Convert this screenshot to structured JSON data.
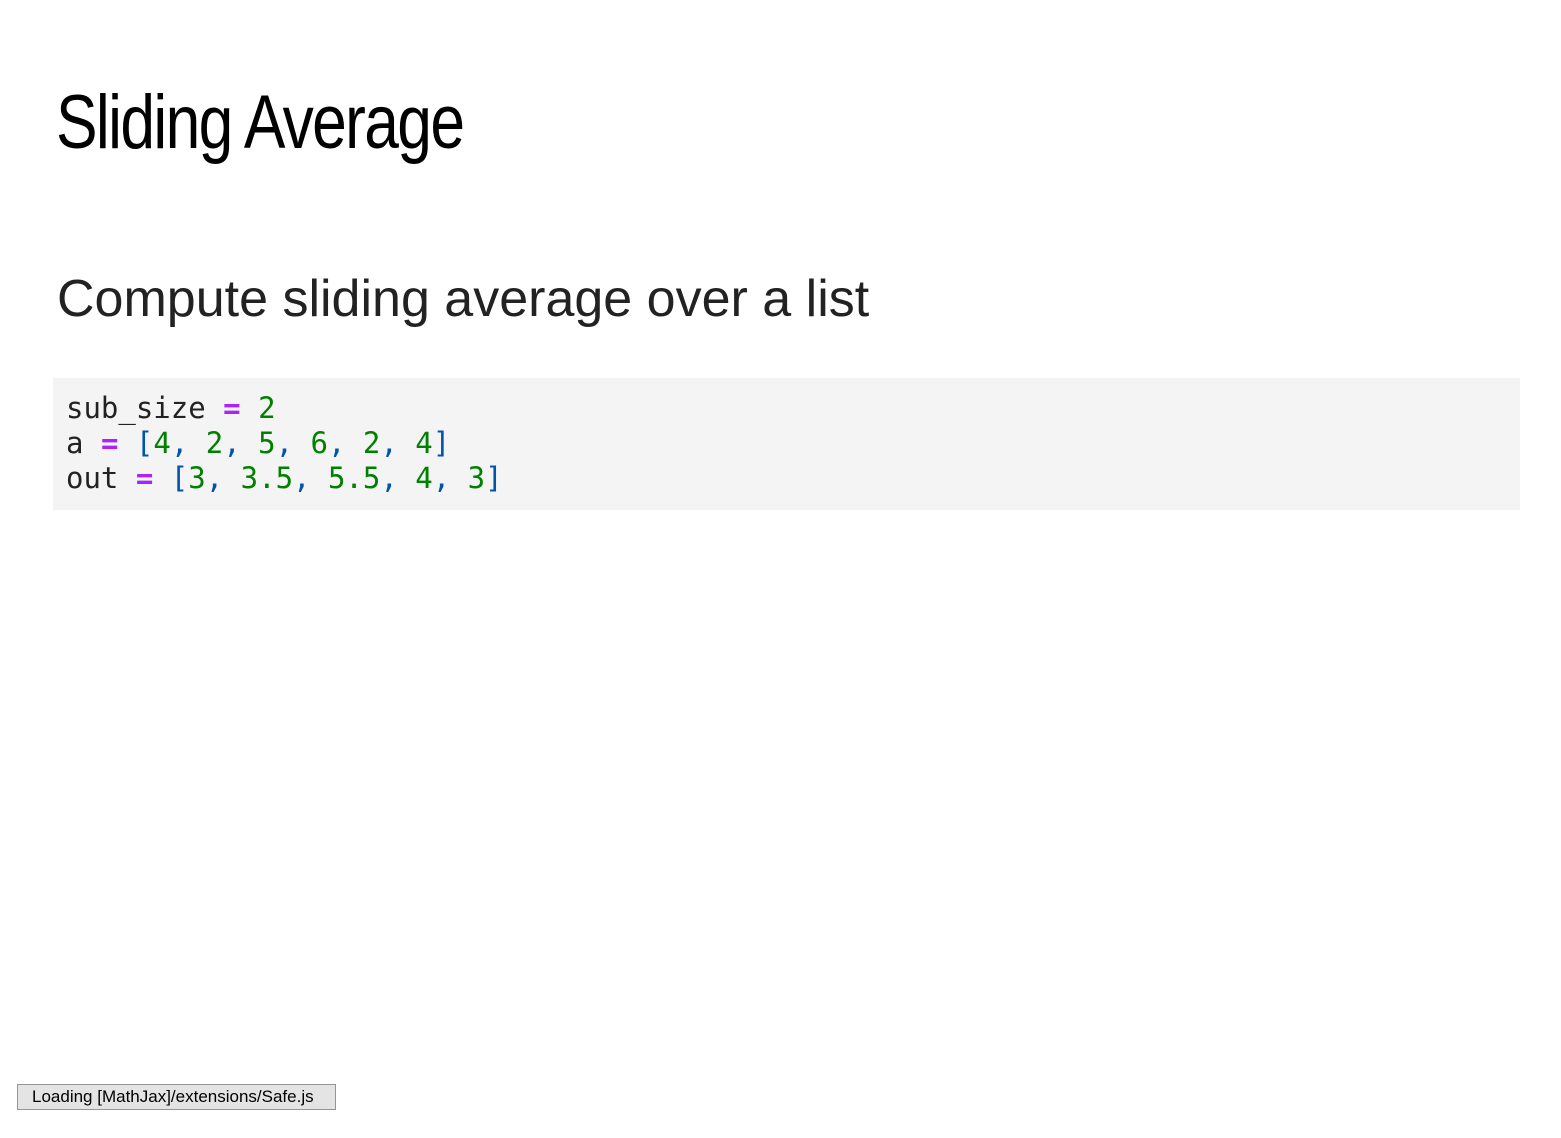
{
  "slide": {
    "title": "Sliding Average",
    "subtitle": "Compute sliding average over a list"
  },
  "code": {
    "lines": [
      {
        "tokens": [
          {
            "text": "sub_size",
            "kind": "name"
          },
          {
            "text": " ",
            "kind": "space"
          },
          {
            "text": "=",
            "kind": "op"
          },
          {
            "text": " ",
            "kind": "space"
          },
          {
            "text": "2",
            "kind": "num"
          }
        ]
      },
      {
        "tokens": [
          {
            "text": "a",
            "kind": "name"
          },
          {
            "text": " ",
            "kind": "space"
          },
          {
            "text": "=",
            "kind": "op"
          },
          {
            "text": " ",
            "kind": "space"
          },
          {
            "text": "[",
            "kind": "punc"
          },
          {
            "text": "4",
            "kind": "num"
          },
          {
            "text": ", ",
            "kind": "punc"
          },
          {
            "text": "2",
            "kind": "num"
          },
          {
            "text": ", ",
            "kind": "punc"
          },
          {
            "text": "5",
            "kind": "num"
          },
          {
            "text": ", ",
            "kind": "punc"
          },
          {
            "text": "6",
            "kind": "num"
          },
          {
            "text": ", ",
            "kind": "punc"
          },
          {
            "text": "2",
            "kind": "num"
          },
          {
            "text": ", ",
            "kind": "punc"
          },
          {
            "text": "4",
            "kind": "num"
          },
          {
            "text": "]",
            "kind": "punc"
          }
        ]
      },
      {
        "tokens": [
          {
            "text": "out",
            "kind": "name"
          },
          {
            "text": " ",
            "kind": "space"
          },
          {
            "text": "=",
            "kind": "op"
          },
          {
            "text": " ",
            "kind": "space"
          },
          {
            "text": "[",
            "kind": "punc"
          },
          {
            "text": "3",
            "kind": "num"
          },
          {
            "text": ", ",
            "kind": "punc"
          },
          {
            "text": "3.5",
            "kind": "num"
          },
          {
            "text": ", ",
            "kind": "punc"
          },
          {
            "text": "5.5",
            "kind": "num"
          },
          {
            "text": ", ",
            "kind": "punc"
          },
          {
            "text": "4",
            "kind": "num"
          },
          {
            "text": ", ",
            "kind": "punc"
          },
          {
            "text": "3",
            "kind": "num"
          },
          {
            "text": "]",
            "kind": "punc"
          }
        ]
      }
    ]
  },
  "colors": {
    "operator": "#aa22ff",
    "number": "#008000",
    "punctuation": "#0055aa",
    "code_background": "#f4f4f4"
  },
  "status": {
    "message": "Loading [MathJax]/extensions/Safe.js"
  }
}
